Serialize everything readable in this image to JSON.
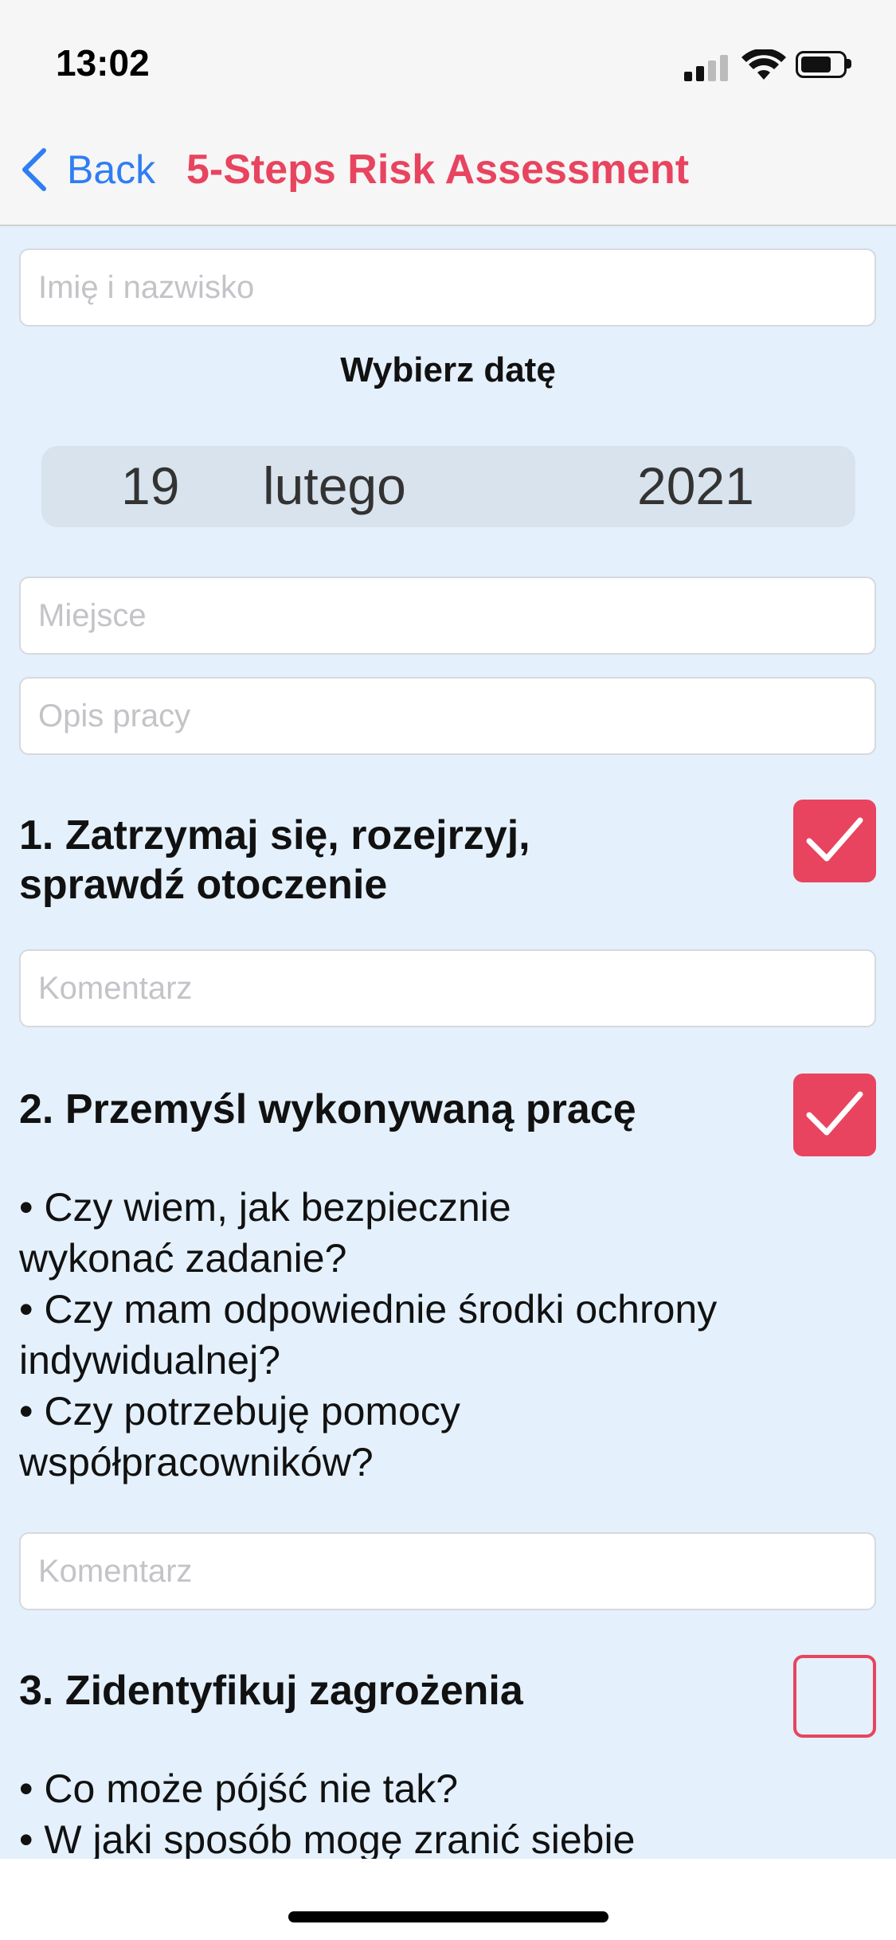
{
  "status_bar": {
    "time": "13:02",
    "icons": [
      "cellular-signal-icon",
      "wifi-icon",
      "battery-icon"
    ]
  },
  "nav": {
    "back_label": "Back",
    "title": "5-Steps Risk Assessment"
  },
  "form": {
    "name_placeholder": "Imię i nazwisko",
    "date_label": "Wybierz datę",
    "date": {
      "day": "19",
      "month": "lutego",
      "year": "2021"
    },
    "place_placeholder": "Miejsce",
    "job_placeholder": "Opis pracy"
  },
  "steps": [
    {
      "title": "1. Zatrzymaj się, rozejrzyj, sprawdź otoczenie",
      "checked": true,
      "comment_placeholder": "Komentarz"
    },
    {
      "title": "2. Przemyśl wykonywaną pracę",
      "checked": true,
      "bullets": [
        "• Czy wiem, jak bezpiecznie\nwykonać zadanie?",
        "• Czy mam odpowiednie środki ochrony\nindywidualnej?",
        "• Czy potrzebuję pomocy\nwspółpracowników?"
      ],
      "comment_placeholder": "Komentarz"
    },
    {
      "title": "3. Zidentyfikuj zagrożenia",
      "checked": false,
      "bullets": [
        "• Co może pójść nie tak?",
        "• W jaki sposób mogę zranić siebie"
      ]
    }
  ],
  "colors": {
    "accent": "#e8445f",
    "link": "#2f7ef2",
    "background": "#e4f0fb"
  }
}
